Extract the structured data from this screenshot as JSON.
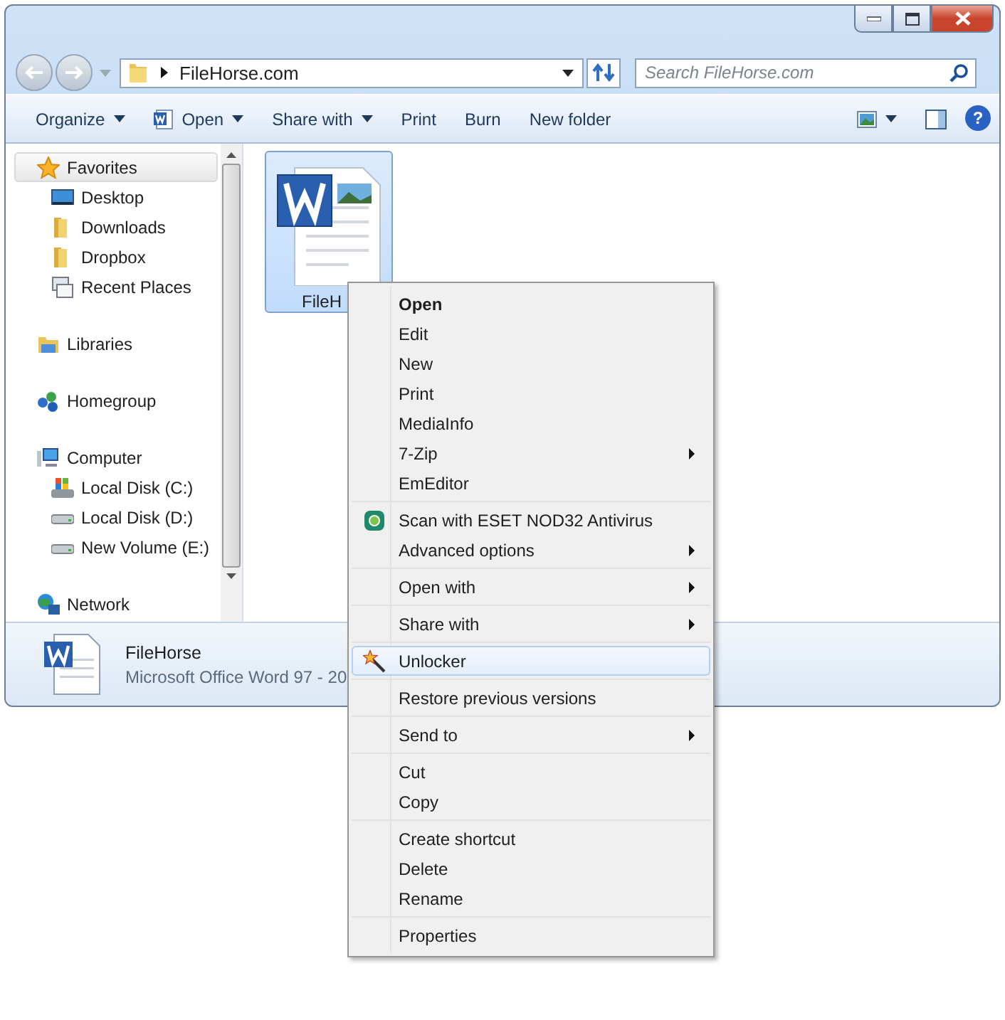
{
  "address": {
    "path": "FileHorse.com"
  },
  "search": {
    "placeholder": "Search FileHorse.com"
  },
  "help": {
    "label": "?"
  },
  "commands": [
    {
      "label": "Organize",
      "kind": "plain",
      "caret": true
    },
    {
      "label": "Open",
      "kind": "word",
      "caret": true
    },
    {
      "label": "Share with",
      "kind": "plain",
      "caret": true
    },
    {
      "label": "Print",
      "kind": "plain",
      "caret": false
    },
    {
      "label": "Burn",
      "kind": "plain",
      "caret": false
    },
    {
      "label": "New folder",
      "kind": "plain",
      "caret": false
    }
  ],
  "sidebar": {
    "items": [
      {
        "label": "Favorites",
        "kind": "star",
        "selected": true,
        "children": [
          {
            "label": "Desktop",
            "kind": "desktop",
            "selected": false
          },
          {
            "label": "Downloads",
            "kind": "folder",
            "selected": false
          },
          {
            "label": "Dropbox",
            "kind": "folder",
            "selected": false
          },
          {
            "label": "Recent Places",
            "kind": "recent",
            "selected": false
          }
        ]
      },
      {
        "label": "Libraries",
        "kind": "libraries",
        "selected": false
      },
      {
        "label": "Homegroup",
        "kind": "homegroup",
        "selected": false
      },
      {
        "label": "Computer",
        "kind": "computer",
        "selected": false,
        "children": [
          {
            "label": "Local Disk (C:)",
            "kind": "sysdisk",
            "selected": false
          },
          {
            "label": "Local Disk (D:)",
            "kind": "disk",
            "selected": false
          },
          {
            "label": "New Volume (E:)",
            "kind": "disk",
            "selected": false
          }
        ]
      },
      {
        "label": "Network",
        "kind": "network",
        "selected": false
      }
    ]
  },
  "files": [
    {
      "name": "FileH",
      "selected": true
    }
  ],
  "details": {
    "name": "FileHorse",
    "type": "Microsoft Office Word 97 - 20"
  },
  "context_menu": {
    "groups": [
      [
        {
          "label": "Open",
          "kind": "default",
          "submenu": false,
          "selected": false
        },
        {
          "label": "Edit",
          "kind": "plain",
          "submenu": false,
          "selected": false
        },
        {
          "label": "New",
          "kind": "plain",
          "submenu": false,
          "selected": false
        },
        {
          "label": "Print",
          "kind": "plain",
          "submenu": false,
          "selected": false
        },
        {
          "label": "MediaInfo",
          "kind": "plain",
          "submenu": false,
          "selected": false
        },
        {
          "label": "7-Zip",
          "kind": "plain",
          "submenu": true,
          "selected": false
        },
        {
          "label": "EmEditor",
          "kind": "plain",
          "submenu": false,
          "selected": false
        }
      ],
      [
        {
          "label": "Scan with ESET NOD32 Antivirus",
          "kind": "antivirus",
          "submenu": false,
          "selected": false
        },
        {
          "label": "Advanced options",
          "kind": "plain",
          "submenu": true,
          "selected": false
        }
      ],
      [
        {
          "label": "Open with",
          "kind": "plain",
          "submenu": true,
          "selected": false
        }
      ],
      [
        {
          "label": "Share with",
          "kind": "plain",
          "submenu": true,
          "selected": false
        }
      ],
      [
        {
          "label": "Unlocker",
          "kind": "unlocker",
          "submenu": false,
          "selected": true
        }
      ],
      [
        {
          "label": "Restore previous versions",
          "kind": "plain",
          "submenu": false,
          "selected": false
        }
      ],
      [
        {
          "label": "Send to",
          "kind": "plain",
          "submenu": true,
          "selected": false
        }
      ],
      [
        {
          "label": "Cut",
          "kind": "plain",
          "submenu": false,
          "selected": false
        },
        {
          "label": "Copy",
          "kind": "plain",
          "submenu": false,
          "selected": false
        }
      ],
      [
        {
          "label": "Create shortcut",
          "kind": "plain",
          "submenu": false,
          "selected": false
        },
        {
          "label": "Delete",
          "kind": "plain",
          "submenu": false,
          "selected": false
        },
        {
          "label": "Rename",
          "kind": "plain",
          "submenu": false,
          "selected": false
        }
      ],
      [
        {
          "label": "Properties",
          "kind": "plain",
          "submenu": false,
          "selected": false
        }
      ]
    ]
  }
}
